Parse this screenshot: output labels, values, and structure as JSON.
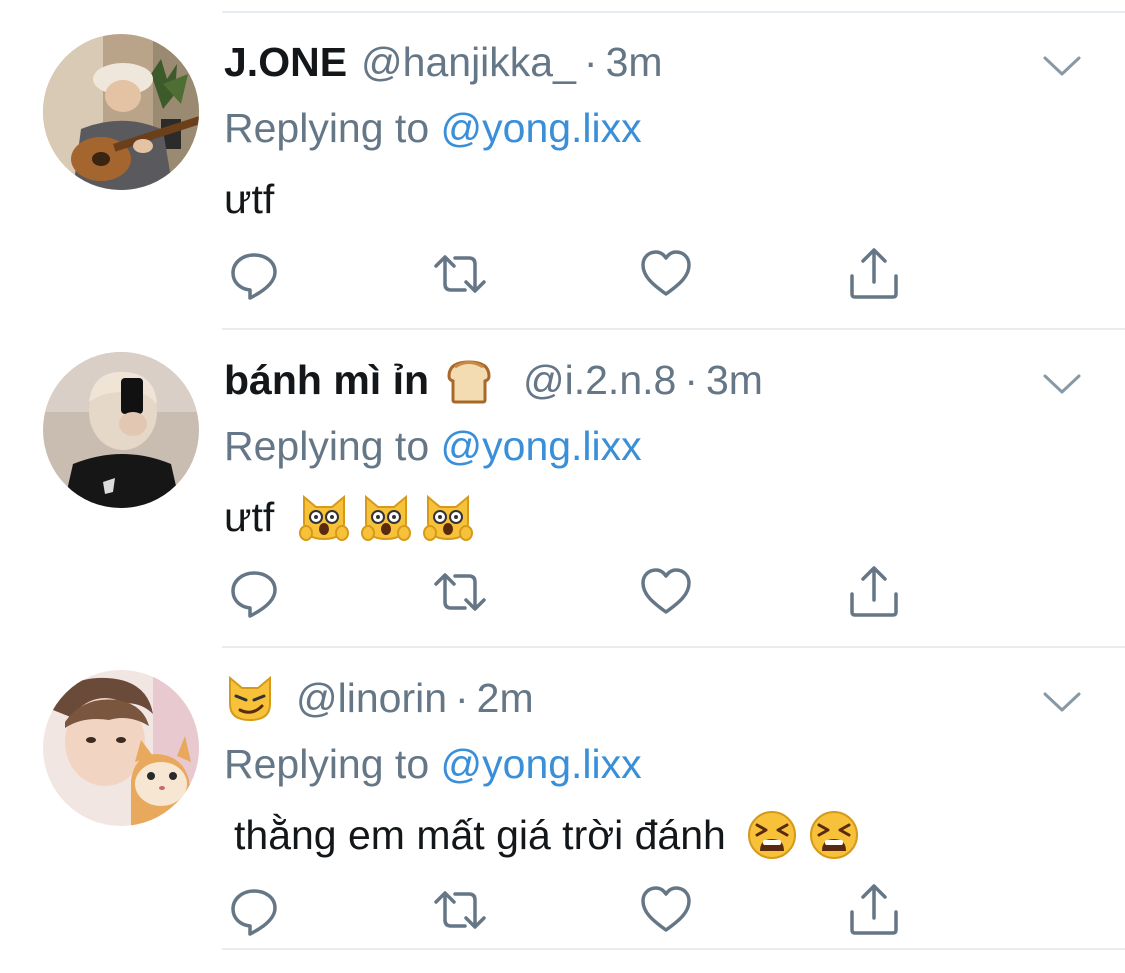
{
  "colors": {
    "link": "#3a8fd9",
    "secondary_text": "#657786",
    "primary_text": "#14171a",
    "divider": "#e6ecf0",
    "icon": "#657786"
  },
  "tweets": [
    {
      "display_name": "J.ONE",
      "name_emoji": "",
      "handle": "@hanjikka_",
      "separator": "·",
      "time": "3m",
      "reply_prefix": "Replying to ",
      "reply_to": "@yong.lixx",
      "text": "ưtf",
      "text_emojis": [],
      "avatar_icon": "guitar-player-avatar"
    },
    {
      "display_name": "bánh mì ỉn",
      "name_emoji": "bread-emoji",
      "handle": "@i.2.n.8",
      "separator": "·",
      "time": "3m",
      "reply_prefix": "Replying to ",
      "reply_to": "@yong.lixx",
      "text": "ưtf",
      "text_emojis": [
        "weary-cat-emoji",
        "weary-cat-emoji",
        "weary-cat-emoji"
      ],
      "avatar_icon": "mirror-selfie-avatar"
    },
    {
      "display_name": "",
      "name_emoji": "smirking-cat-emoji",
      "handle": "@linorin",
      "separator": "·",
      "time": "2m",
      "reply_prefix": "Replying to ",
      "reply_to": "@yong.lixx",
      "text": "thằng em mất giá trời đánh",
      "text_emojis": [
        "tired-face-emoji",
        "tired-face-emoji"
      ],
      "avatar_icon": "person-with-cat-avatar"
    }
  ],
  "actions": [
    "reply-icon",
    "retweet-icon",
    "like-icon",
    "share-icon"
  ],
  "menu_icon": "chevron-down-icon"
}
